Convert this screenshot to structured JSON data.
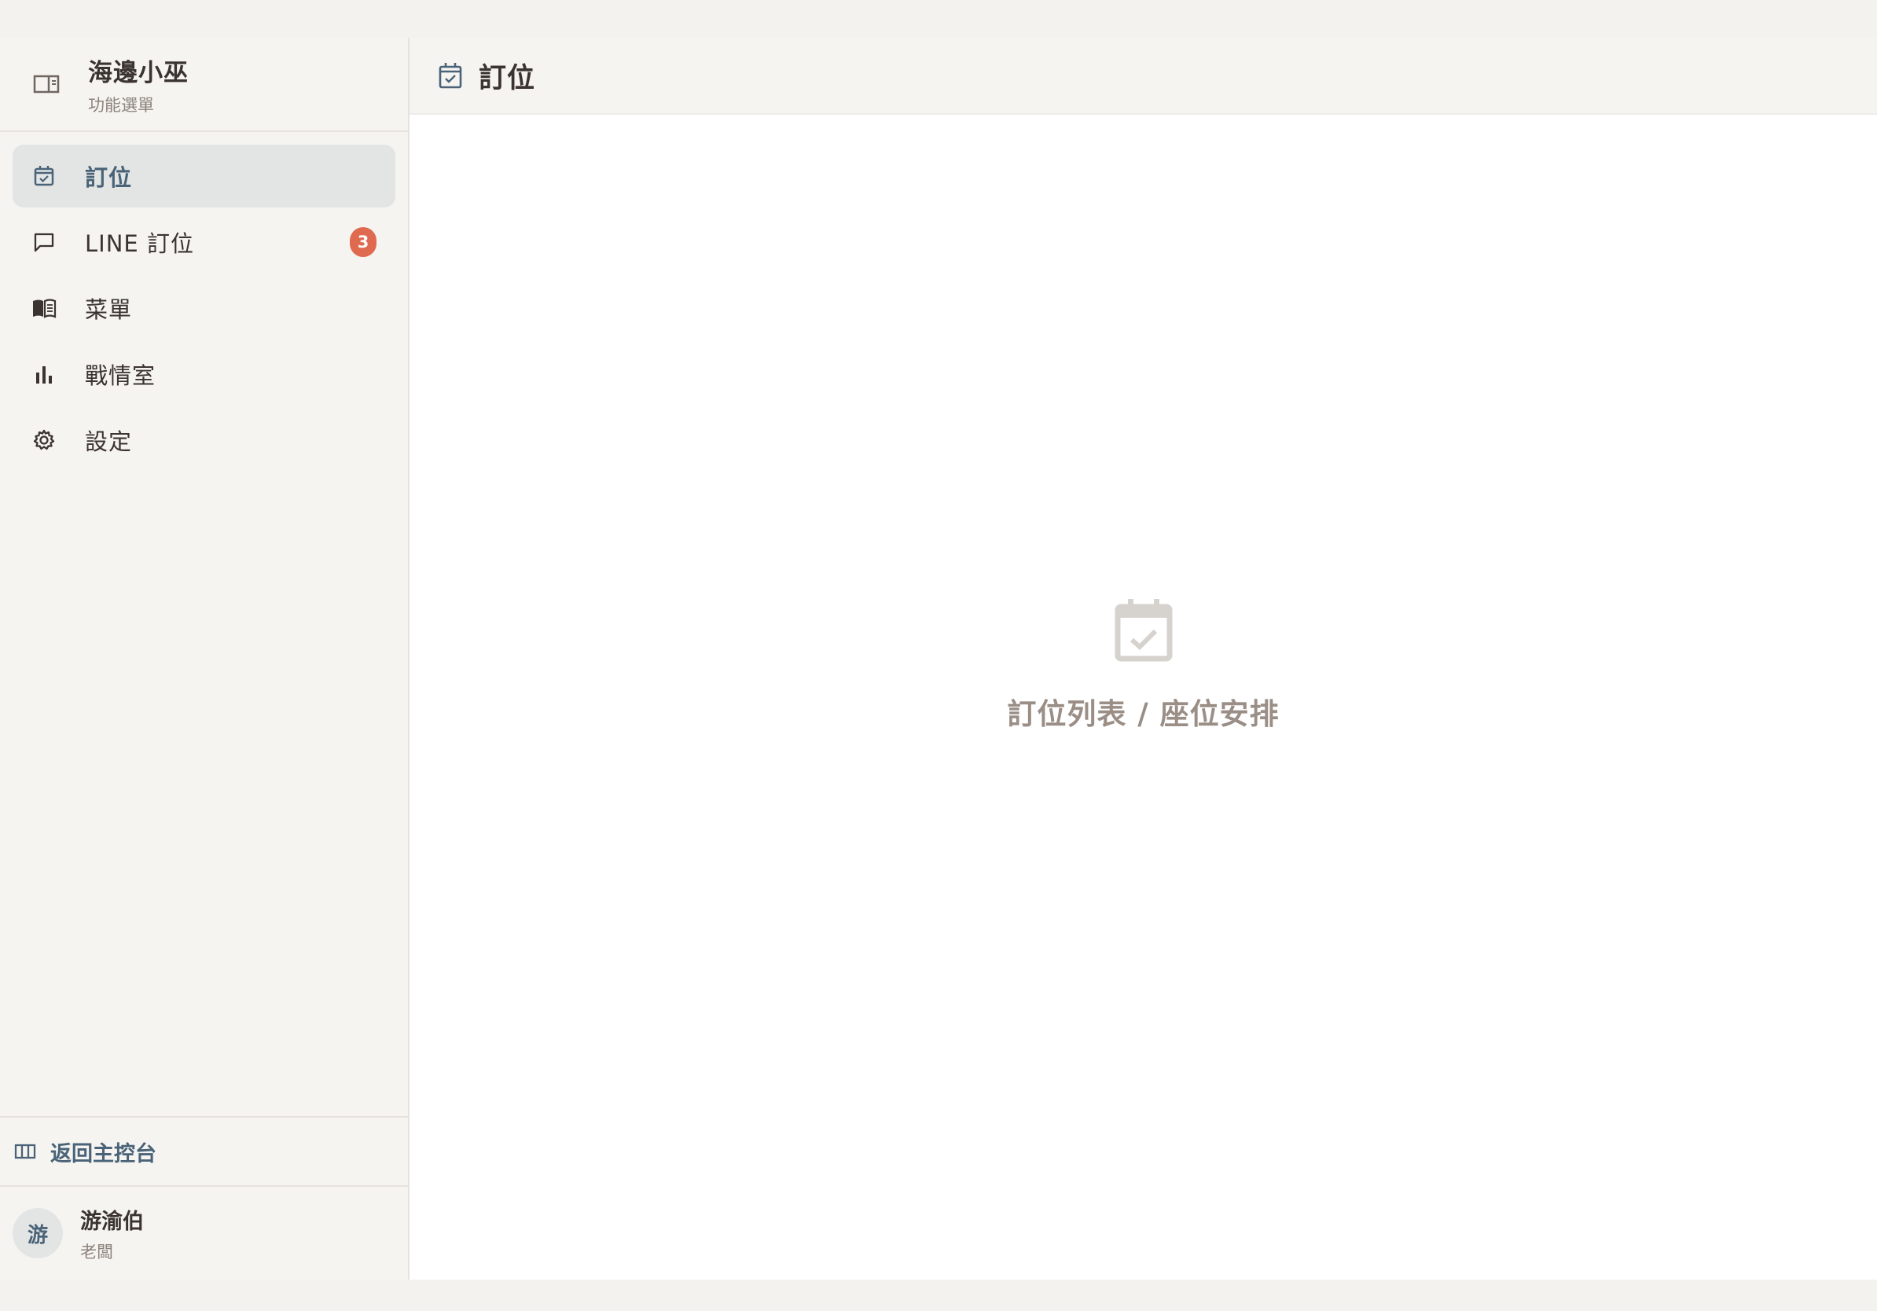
{
  "brand": {
    "title": "海邊小巫",
    "subtitle": "功能選單",
    "icon": "sidebar-panel-icon"
  },
  "nav": {
    "items": [
      {
        "label": "訂位",
        "icon": "calendar-check-icon",
        "active": true
      },
      {
        "label": "LINE 訂位",
        "icon": "chat-bubble-icon",
        "badge": "3"
      },
      {
        "label": "菜單",
        "icon": "menu-book-icon"
      },
      {
        "label": "戰情室",
        "icon": "bar-chart-icon"
      },
      {
        "label": "設定",
        "icon": "gear-icon"
      }
    ]
  },
  "back": {
    "label": "返回主控台",
    "icon": "columns-icon"
  },
  "user": {
    "avatar": "游",
    "name": "游渝伯",
    "role": "老闆"
  },
  "header": {
    "title": "訂位",
    "icon": "calendar-check-icon"
  },
  "empty_state": {
    "text": "訂位列表 / 座位安排",
    "icon": "calendar-check-icon"
  },
  "colors": {
    "accent": "#4a6378",
    "badge": "#e06a4f",
    "active_bg": "#e3e5e4",
    "sidebar_bg": "#f5f4f1"
  }
}
